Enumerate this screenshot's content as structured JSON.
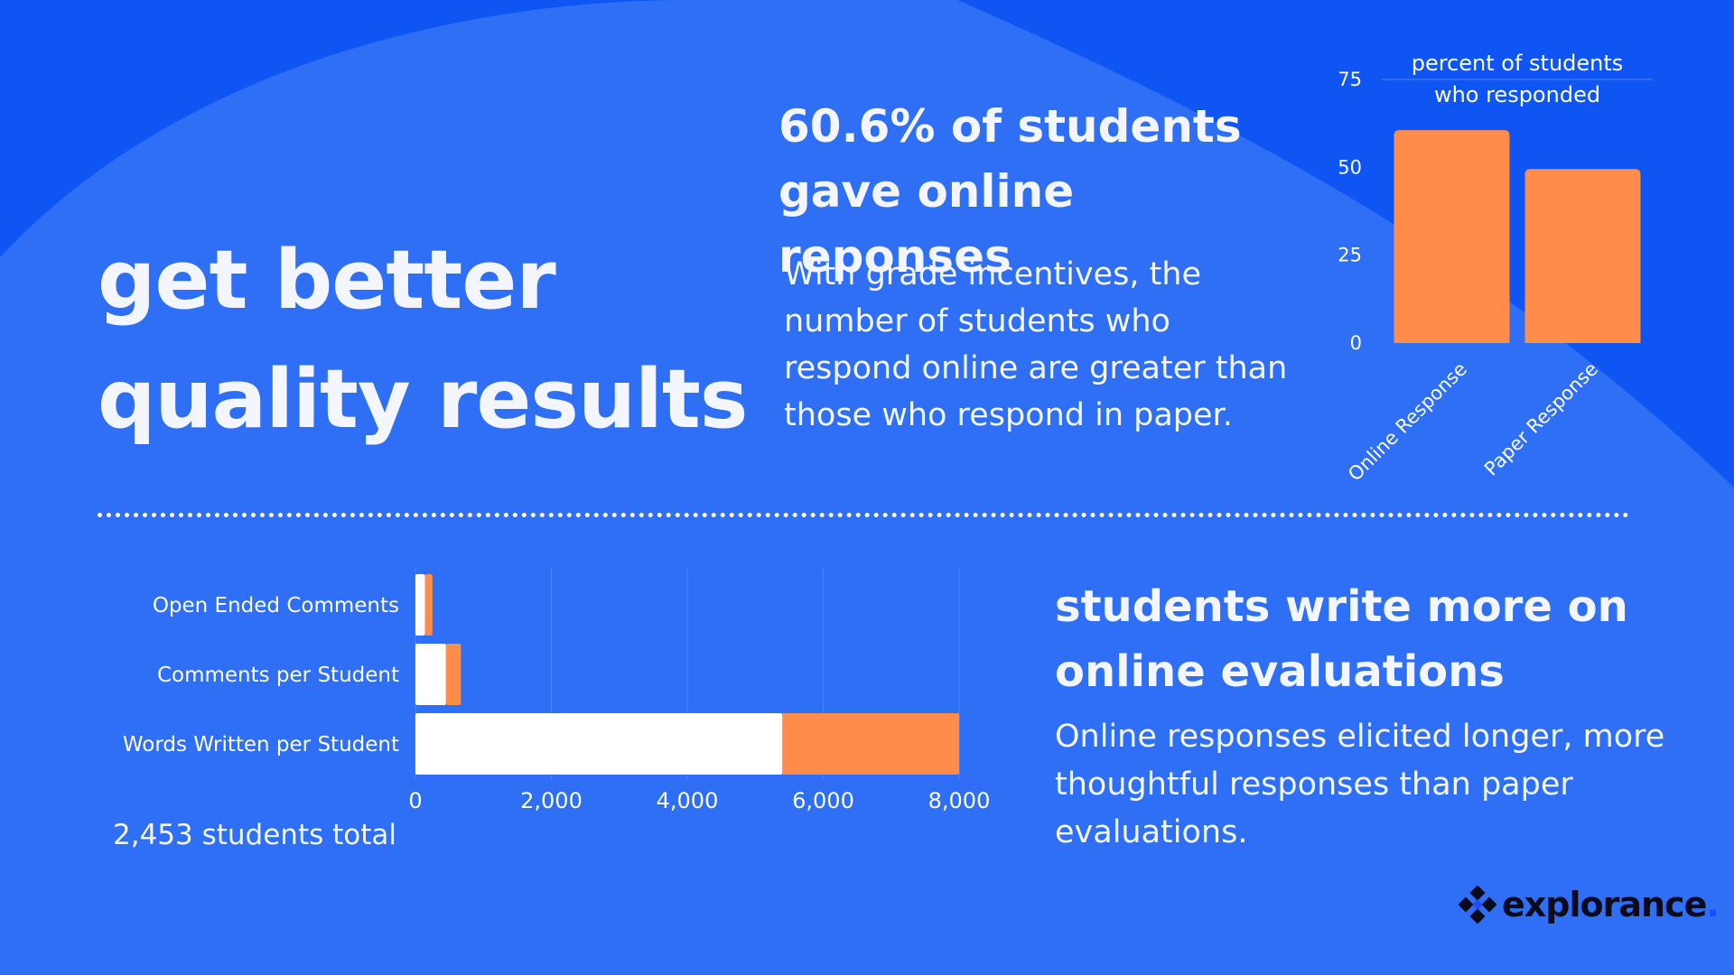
{
  "headline": {
    "line1": "get better",
    "line2": "quality results"
  },
  "stat": {
    "title_line1": "60.6% of students",
    "title_line2": "gave online reponses",
    "body": "With grade incentives, the number of students who respond online are greater than those who respond in paper."
  },
  "write_more": {
    "title_line1": "students write more on",
    "title_line2": "online evaluations",
    "body": "Online responses elicited longer, more thoughtful responses than paper evaluations."
  },
  "total_label": "2,453 students total",
  "brand": {
    "name": "explorance",
    "dot": "."
  },
  "colors": {
    "background": "#2e6ff5",
    "background_dark": "#0e55f4",
    "bar_orange": "#ff8c4a",
    "bar_white": "#ffffff",
    "logo_dark": "#0b0b1e"
  },
  "chart_data": [
    {
      "type": "bar",
      "title": "percent of students who responded",
      "title_lines": [
        "percent of students",
        "who responded"
      ],
      "categories": [
        "Online Response",
        "Paper Response"
      ],
      "values": [
        60.6,
        49.5
      ],
      "ylim": [
        0,
        75
      ],
      "yticks": [
        "0",
        "25",
        "50",
        "75"
      ],
      "color": "#ff8c4a",
      "grid": false,
      "xlabel": "",
      "ylabel": ""
    },
    {
      "type": "bar",
      "orientation": "horizontal",
      "stacked": true,
      "categories": [
        "Open Ended Comments",
        "Comments per Student",
        "Words Written per Student"
      ],
      "series": [
        {
          "values": [
            140,
            450,
            5400
          ],
          "color": "#ffffff"
        },
        {
          "values": [
            110,
            220,
            2600
          ],
          "color": "#ff8c4a"
        }
      ],
      "xlim": [
        0,
        8000
      ],
      "xticks": [
        "0",
        "2,000",
        "4,000",
        "6,000",
        "8,000"
      ],
      "grid": true,
      "xlabel": "",
      "ylabel": ""
    }
  ]
}
